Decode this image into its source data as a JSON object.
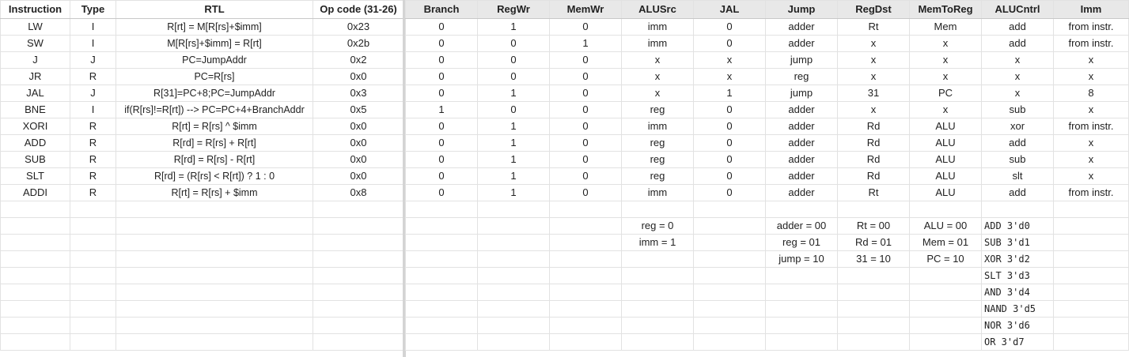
{
  "left": {
    "headers": [
      "Instruction",
      "Type",
      "RTL",
      "Op code (31-26)"
    ],
    "rows": [
      [
        "LW",
        "I",
        "R[rt] = M[R[rs]+$imm]",
        "0x23"
      ],
      [
        "SW",
        "I",
        "M[R[rs]+$imm] = R[rt]",
        "0x2b"
      ],
      [
        "J",
        "J",
        "PC=JumpAddr",
        "0x2"
      ],
      [
        "JR",
        "R",
        "PC=R[rs]",
        "0x0"
      ],
      [
        "JAL",
        "J",
        "R[31]=PC+8;PC=JumpAddr",
        "0x3"
      ],
      [
        "BNE",
        "I",
        "if(R[rs]!=R[rt])  -->  PC=PC+4+BranchAddr",
        "0x5"
      ],
      [
        "XORI",
        "R",
        "R[rt] = R[rs] ^ $imm",
        "0x0"
      ],
      [
        "ADD",
        "R",
        "R[rd] = R[rs] + R[rt]",
        "0x0"
      ],
      [
        "SUB",
        "R",
        "R[rd] = R[rs] - R[rt]",
        "0x0"
      ],
      [
        "SLT",
        "R",
        "R[rd] = (R[rs] < R[rt]) ? 1 : 0",
        "0x0"
      ],
      [
        "ADDI",
        "R",
        "R[rt] = R[rs] + $imm",
        "0x8"
      ]
    ]
  },
  "right": {
    "headers": [
      "Branch",
      "RegWr",
      "MemWr",
      "ALUSrc",
      "JAL",
      "Jump",
      "RegDst",
      "MemToReg",
      "ALUCntrl",
      "Imm"
    ],
    "rows": [
      [
        "0",
        "1",
        "0",
        "imm",
        "0",
        "adder",
        "Rt",
        "Mem",
        "add",
        "from instr."
      ],
      [
        "0",
        "0",
        "1",
        "imm",
        "0",
        "adder",
        "x",
        "x",
        "add",
        "from instr."
      ],
      [
        "0",
        "0",
        "0",
        "x",
        "x",
        "jump",
        "x",
        "x",
        "x",
        "x"
      ],
      [
        "0",
        "0",
        "0",
        "x",
        "x",
        "reg",
        "x",
        "x",
        "x",
        "x"
      ],
      [
        "0",
        "1",
        "0",
        "x",
        "1",
        "jump",
        "31",
        "PC",
        "x",
        "8"
      ],
      [
        "1",
        "0",
        "0",
        "reg",
        "0",
        "adder",
        "x",
        "x",
        "sub",
        "x"
      ],
      [
        "0",
        "1",
        "0",
        "imm",
        "0",
        "adder",
        "Rd",
        "ALU",
        "xor",
        "from instr."
      ],
      [
        "0",
        "1",
        "0",
        "reg",
        "0",
        "adder",
        "Rd",
        "ALU",
        "add",
        "x"
      ],
      [
        "0",
        "1",
        "0",
        "reg",
        "0",
        "adder",
        "Rd",
        "ALU",
        "sub",
        "x"
      ],
      [
        "0",
        "1",
        "0",
        "reg",
        "0",
        "adder",
        "Rd",
        "ALU",
        "slt",
        "x"
      ],
      [
        "0",
        "1",
        "0",
        "imm",
        "0",
        "adder",
        "Rt",
        "ALU",
        "add",
        "from instr."
      ]
    ],
    "legend_rows": [
      [
        "",
        "",
        "",
        "",
        "",
        "",
        "",
        "",
        "",
        ""
      ],
      [
        "",
        "",
        "",
        "reg = 0",
        "",
        "adder = 00",
        "Rt = 00",
        "ALU = 00",
        "ADD 3'd0",
        ""
      ],
      [
        "",
        "",
        "",
        "imm = 1",
        "",
        "reg = 01",
        "Rd = 01",
        "Mem = 01",
        "SUB 3'd1",
        ""
      ],
      [
        "",
        "",
        "",
        "",
        "",
        "jump = 10",
        "31 = 10",
        "PC = 10",
        "XOR 3'd2",
        ""
      ],
      [
        "",
        "",
        "",
        "",
        "",
        "",
        "",
        "",
        "SLT 3'd3",
        ""
      ],
      [
        "",
        "",
        "",
        "",
        "",
        "",
        "",
        "",
        "AND 3'd4",
        ""
      ],
      [
        "",
        "",
        "",
        "",
        "",
        "",
        "",
        "",
        "NAND 3'd5",
        ""
      ],
      [
        "",
        "",
        "",
        "",
        "",
        "",
        "",
        "",
        "NOR 3'd6",
        ""
      ],
      [
        "",
        "",
        "",
        "",
        "",
        "",
        "",
        "",
        "OR 3'd7",
        ""
      ]
    ]
  }
}
